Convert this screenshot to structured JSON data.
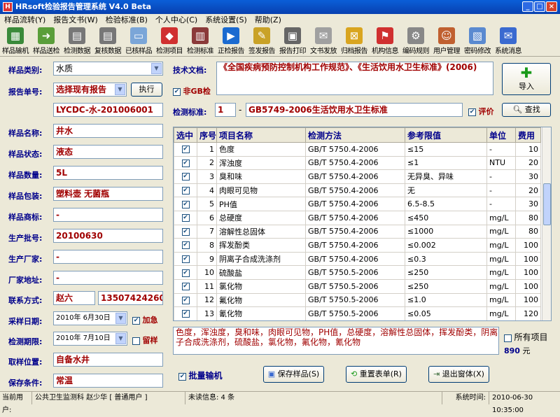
{
  "app": {
    "title": "HRsoft检验报告管理系统 V4.0 Beta"
  },
  "menu": [
    "样品流转(Y)",
    "报告文书(W)",
    "检验标准(B)",
    "个人中心(C)",
    "系统设置(S)",
    "帮助(Z)"
  ],
  "toolbar": [
    {
      "label": "样品输机",
      "icon": "sample-input-icon",
      "color": "#3a8a3a",
      "glyph": "▦"
    },
    {
      "label": "样品送检",
      "icon": "sample-send-icon",
      "color": "#5a9e3a",
      "glyph": "➜"
    },
    {
      "label": "检测数据",
      "icon": "calculator-icon",
      "color": "#777",
      "glyph": "▤"
    },
    {
      "label": "复核数据",
      "icon": "calculator-icon",
      "color": "#777",
      "glyph": "▤"
    },
    {
      "label": "已核样品",
      "icon": "folder-icon",
      "color": "#7ba6d8",
      "glyph": "▭"
    },
    {
      "label": "检测项目",
      "icon": "cubes-icon",
      "color": "#d03030",
      "glyph": "◆"
    },
    {
      "label": "检测标准",
      "icon": "book-icon",
      "color": "#8b3a3a",
      "glyph": "▥"
    },
    {
      "label": "正检报告",
      "icon": "play-icon",
      "color": "#1a6ad0",
      "glyph": "▶"
    },
    {
      "label": "签发报告",
      "icon": "sign-icon",
      "color": "#c9a227",
      "glyph": "✎"
    },
    {
      "label": "报告打印",
      "icon": "printer-icon",
      "color": "#666",
      "glyph": "▣"
    },
    {
      "label": "文书发放",
      "icon": "mail-icon",
      "color": "#a0a0a0",
      "glyph": "✉"
    },
    {
      "label": "归档报告",
      "icon": "lock-icon",
      "color": "#d9a520",
      "glyph": "⊠"
    },
    {
      "label": "机构信息",
      "icon": "flag-icon",
      "color": "#d03030",
      "glyph": "⚑"
    },
    {
      "label": "编码规则",
      "icon": "gear-icon",
      "color": "#888",
      "glyph": "⚙"
    },
    {
      "label": "用户管理",
      "icon": "users-icon",
      "color": "#c06030",
      "glyph": "☺"
    },
    {
      "label": "密码修改",
      "icon": "id-card-icon",
      "color": "#5a8ad0",
      "glyph": "▧"
    },
    {
      "label": "系统消息",
      "icon": "message-icon",
      "color": "#3a6ad0",
      "glyph": "✉"
    }
  ],
  "form": {
    "sample_type_label": "样品类别:",
    "sample_type": "水质",
    "report_no_label": "报告单号:",
    "report_select": "选择现有报告",
    "exec_btn": "执行",
    "report_no": "LYCDC-水-201006001",
    "name_label": "样品名称:",
    "name": "井水",
    "state_label": "样品状态:",
    "state": "液态",
    "qty_label": "样品数量:",
    "qty": "5L",
    "pack_label": "样品包装:",
    "pack": "塑料壶 无菌瓶",
    "brand_label": "样品商标:",
    "brand": "-",
    "batch_label": "生产批号:",
    "batch": "20100630",
    "maker_label": "生产厂家:",
    "maker": "-",
    "addr_label": "厂家地址:",
    "addr": "-",
    "contact_label": "联系方式:",
    "contact_name": "赵六",
    "contact_phone": "13507424260",
    "sample_date_label": "采样日期:",
    "sample_date": "2010年 6月30日",
    "urgent": "加急",
    "test_deadline_label": "检测期限:",
    "test_deadline": "2010年 7月10日",
    "keep": "留样",
    "location_label": "取样位置:",
    "location": "自备水井",
    "storage_label": "保存条件:",
    "storage": "常温"
  },
  "right": {
    "tech_doc_label": "技术文档:",
    "tech_doc": "《全国疾病预防控制机构工作规范》、《生活饮用水卫生标准》(2006)",
    "non_gb": "非GB检",
    "import_btn": "导入",
    "std_label": "检测标准:",
    "std_no": "1",
    "std_dash": "-",
    "std_name": "GB5749-2006生活饮用水卫生标准",
    "evaluate": "评价",
    "search_btn": "查找",
    "summary": "色度，浑浊度，臭和味，肉眼可见物，PH值，总硬度，溶解性总固体，挥发酚类，阴离子合成洗涤剂，硫酸盐，氯化物，氟化物，氰化物",
    "all_items": "所有项目",
    "total": "890",
    "currency": "元",
    "batch_input": "批量输机",
    "save_btn": "保存样品(S)",
    "reset_btn": "重置表单(R)",
    "exit_btn": "退出窗体(X)"
  },
  "table": {
    "headers": [
      "选中",
      "序号",
      "项目名称",
      "检测方法",
      "参考限值",
      "单位",
      "费用"
    ],
    "rows": [
      [
        "1",
        "色度",
        "GB/T 5750.4-2006",
        "≤15",
        "-",
        "10"
      ],
      [
        "2",
        "浑浊度",
        "GB/T 5750.4-2006",
        "≤1",
        "NTU",
        "20"
      ],
      [
        "3",
        "臭和味",
        "GB/T 5750.4-2006",
        "无异臭、异味",
        "-",
        "30"
      ],
      [
        "4",
        "肉眼可见物",
        "GB/T 5750.4-2006",
        "无",
        "-",
        "20"
      ],
      [
        "5",
        "PH值",
        "GB/T 5750.4-2006",
        "6.5-8.5",
        "-",
        "30"
      ],
      [
        "6",
        "总硬度",
        "GB/T 5750.4-2006",
        "≤450",
        "mg/L",
        "80"
      ],
      [
        "7",
        "溶解性总固体",
        "GB/T 5750.4-2006",
        "≤1000",
        "mg/L",
        "80"
      ],
      [
        "8",
        "挥发酚类",
        "GB/T 5750.4-2006",
        "≤0.002",
        "mg/L",
        "100"
      ],
      [
        "9",
        "阴离子合成洗涤剂",
        "GB/T 5750.4-2006",
        "≤0.3",
        "mg/L",
        "100"
      ],
      [
        "10",
        "硫酸盐",
        "GB/T 5750.5-2006",
        "≤250",
        "mg/L",
        "100"
      ],
      [
        "11",
        "氯化物",
        "GB/T 5750.5-2006",
        "≤250",
        "mg/L",
        "100"
      ],
      [
        "12",
        "氟化物",
        "GB/T 5750.5-2006",
        "≤1.0",
        "mg/L",
        "100"
      ],
      [
        "13",
        "氰化物",
        "GB/T 5750.5-2006",
        "≤0.05",
        "mg/L",
        "120"
      ]
    ]
  },
  "status": {
    "current_user_label": "当前用户:",
    "current_user": "公共卫生监测科 赵少华 [ 普通用户 ]",
    "unread": "未读信息: 4 条",
    "sys_time_label": "系统时间:",
    "sys_time": "2010-06-30 10:35:00"
  }
}
